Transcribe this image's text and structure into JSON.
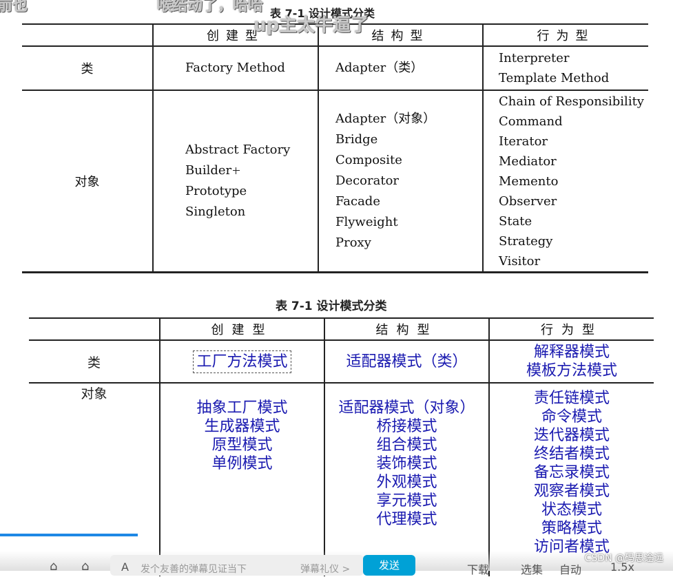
{
  "danmaku": [
    "前也",
    "喉结动了，哈哈",
    "up主太牛逼了"
  ],
  "table1": {
    "caption": "表 7-1   设计模式分类",
    "headers": [
      "",
      "创建型",
      "结构型",
      "行为型"
    ],
    "rows": [
      {
        "label": "类",
        "creational": [
          "Factory Method"
        ],
        "structural": [
          "Adapter（类）"
        ],
        "behavioral": [
          "Interpreter",
          "Template Method"
        ]
      },
      {
        "label": "对象",
        "creational": [
          "Abstract Factory",
          "Builder",
          "Prototype",
          "Singleton"
        ],
        "structural": [
          "Adapter（对象）",
          "Bridge",
          "Composite",
          "Decorator",
          "Facade",
          "Flyweight",
          "Proxy"
        ],
        "behavioral": [
          "Chain of Responsibility",
          "Command",
          "Iterator",
          "Mediator",
          "Memento",
          "Observer",
          "State",
          "Strategy",
          "Visitor"
        ]
      }
    ]
  },
  "table2": {
    "caption": "表 7-1   设计模式分类",
    "headers": [
      "",
      "创建型",
      "结构型",
      "行为型"
    ],
    "rows": [
      {
        "label": "类",
        "creational": [
          "工厂方法模式"
        ],
        "structural": [
          "适配器模式（类）"
        ],
        "behavioral": [
          "解释器模式",
          "模板方法模式"
        ]
      },
      {
        "label": "对象",
        "creational": [
          "抽象工厂模式",
          "生成器模式",
          "原型模式",
          "单例模式"
        ],
        "structural": [
          "适配器模式（对象）",
          "桥接模式",
          "组合模式",
          "装饰模式",
          "外观模式",
          "享元模式",
          "代理模式"
        ],
        "behavioral": [
          "责任链模式",
          "命令模式",
          "迭代器模式",
          "终结者模式",
          "备忘录模式",
          "观察者模式",
          "状态模式",
          "策略模式",
          "访问者模式"
        ]
      }
    ]
  },
  "player": {
    "input_placeholder": "发个友善的弹幕见证当下",
    "etiquette": "弹幕礼仪 >",
    "send": "发送",
    "download": "下载",
    "select": "选集",
    "auto": "自动",
    "speed": "1.5x"
  },
  "watermark": "CSDN @码思途远",
  "colors": {
    "accent": "#00a1d6",
    "pattern_text": "#1a1ab0",
    "progress": "#1e88e5"
  }
}
